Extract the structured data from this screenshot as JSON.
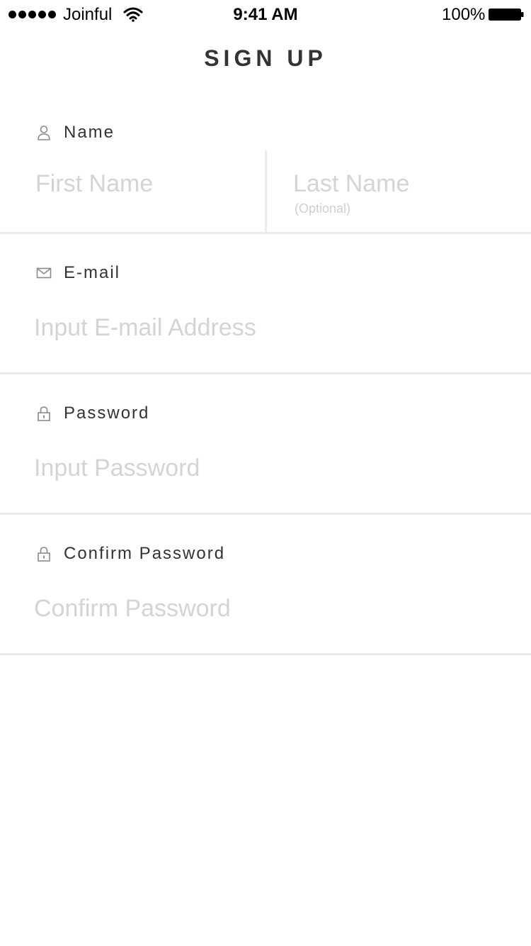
{
  "status_bar": {
    "carrier": "Joinful",
    "time": "9:41 AM",
    "battery": "100%"
  },
  "page": {
    "title": "SIGN UP"
  },
  "form": {
    "name": {
      "label": "Name",
      "icon": "person-icon",
      "first_placeholder": "First Name",
      "last_placeholder": "Last Name",
      "last_hint": "(Optional)"
    },
    "email": {
      "label": "E-mail",
      "icon": "envelope-icon",
      "placeholder": "Input E-mail Address"
    },
    "password": {
      "label": "Password",
      "icon": "lock-icon",
      "placeholder": "Input Password"
    },
    "confirm_password": {
      "label": "Confirm Password",
      "icon": "lock-icon",
      "placeholder": "Confirm Password"
    }
  },
  "colors": {
    "text": "#333333",
    "placeholder": "#d4d4d4",
    "divider": "#ebebeb"
  }
}
